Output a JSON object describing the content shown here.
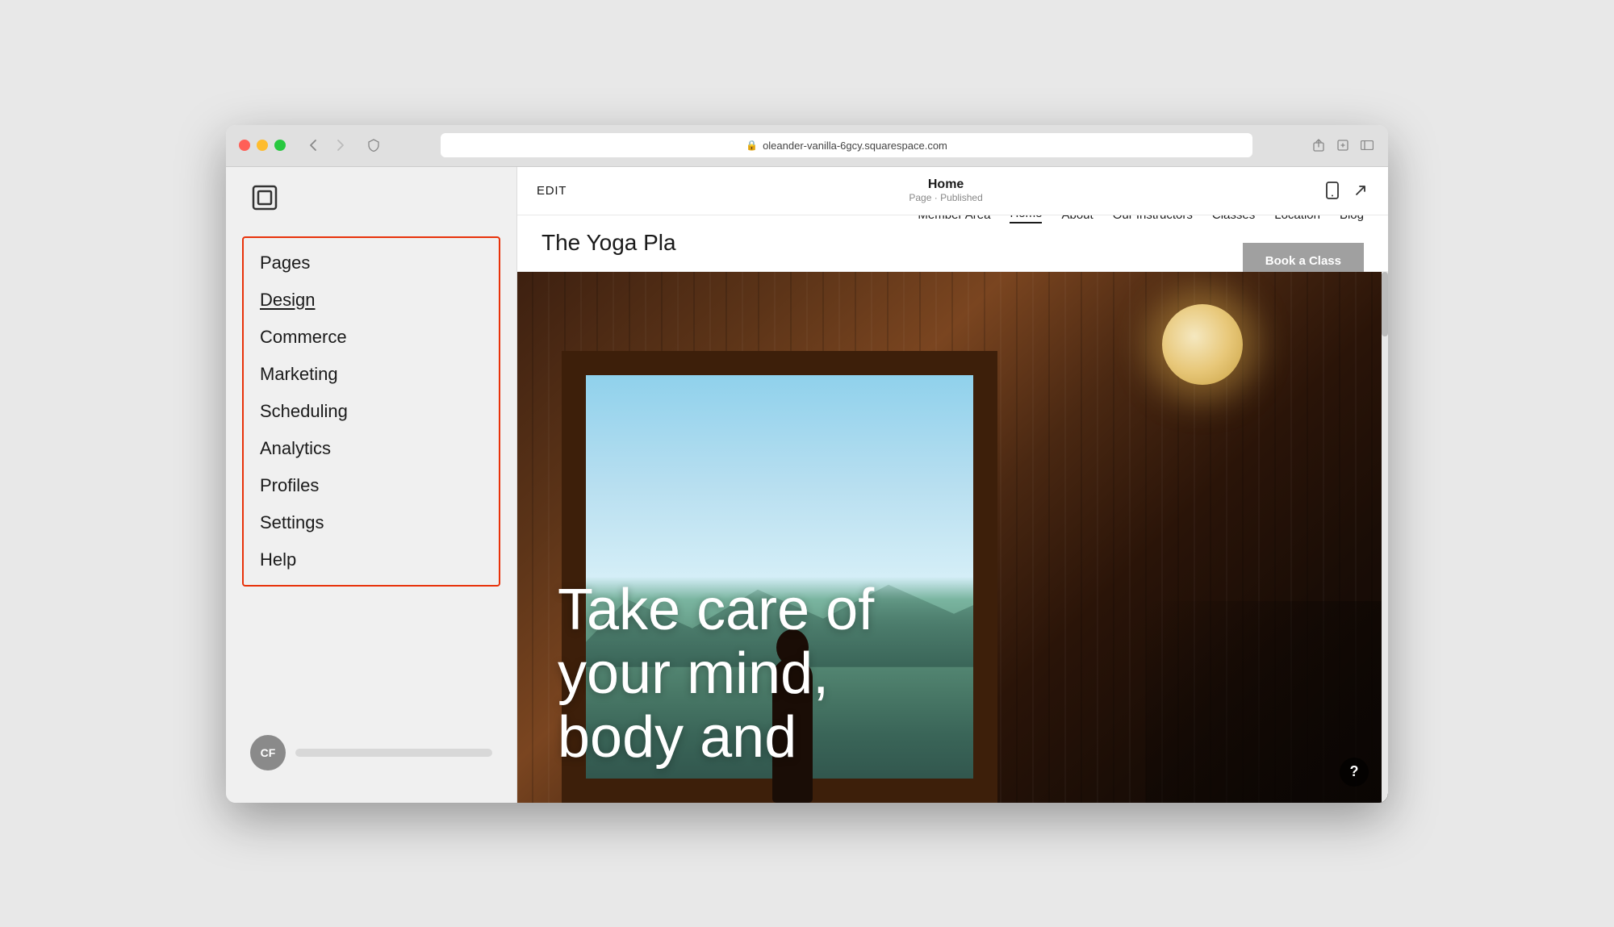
{
  "window": {
    "title": "oleander-vanilla-6gcy.squarespace.com",
    "traffic_lights": [
      "red",
      "yellow",
      "green"
    ]
  },
  "editor_bar": {
    "edit_label": "EDIT",
    "page_name": "Home",
    "page_status": "Page · Published"
  },
  "sidebar": {
    "logo_label": "Squarespace logo",
    "nav_items": [
      {
        "id": "pages",
        "label": "Pages",
        "active": false
      },
      {
        "id": "design",
        "label": "Design",
        "active": true
      },
      {
        "id": "commerce",
        "label": "Commerce",
        "active": false
      },
      {
        "id": "marketing",
        "label": "Marketing",
        "active": false
      },
      {
        "id": "scheduling",
        "label": "Scheduling",
        "active": false
      },
      {
        "id": "analytics",
        "label": "Analytics",
        "active": false
      },
      {
        "id": "profiles",
        "label": "Profiles",
        "active": false
      },
      {
        "id": "settings",
        "label": "Settings",
        "active": false
      },
      {
        "id": "help",
        "label": "Help",
        "active": false
      }
    ],
    "user_initials": "CF"
  },
  "site_nav": {
    "logo": "The Yoga Pla",
    "links": [
      {
        "id": "member-area",
        "label": "Member Area",
        "active": false
      },
      {
        "id": "home",
        "label": "Home",
        "active": true
      },
      {
        "id": "about",
        "label": "About",
        "active": false
      },
      {
        "id": "our-instructors",
        "label": "Our Instructors",
        "active": false
      },
      {
        "id": "classes",
        "label": "Classes",
        "active": false
      },
      {
        "id": "location",
        "label": "Location",
        "active": false
      },
      {
        "id": "blog",
        "label": "Blog",
        "active": false
      }
    ],
    "cta_button": "Book a Class"
  },
  "hero": {
    "headline_line1": "Take care of",
    "headline_line2": "your mind,",
    "headline_line3": "body and"
  },
  "help_button": "?"
}
